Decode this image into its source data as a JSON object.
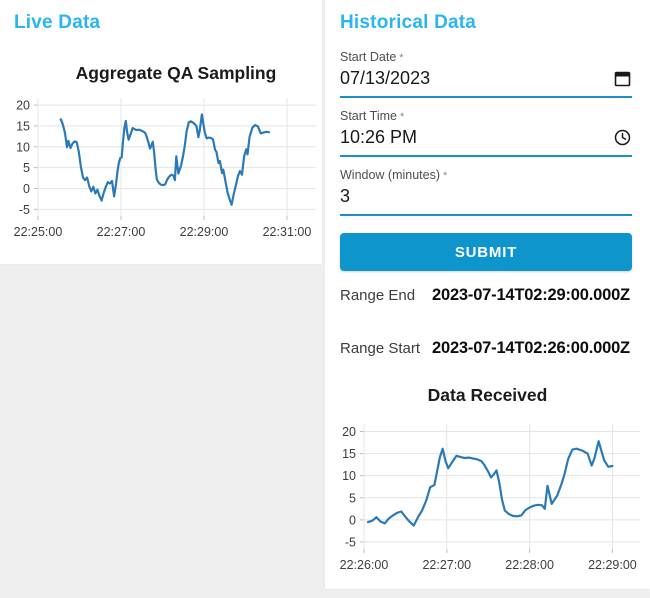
{
  "theme": {
    "accent": "#29b5f2",
    "button_bg": "#0e96cc",
    "line_color": "#2b7ab8",
    "underline": "#1b8fc9"
  },
  "live_panel": {
    "title": "Live Data"
  },
  "historical_panel": {
    "title": "Historical Data",
    "fields": [
      {
        "label": "Start Date",
        "required_mark": "*",
        "value": "07/13/2023",
        "icon": "calendar-icon"
      },
      {
        "label": "Start Time",
        "required_mark": "*",
        "value": "10:26 PM",
        "icon": "clock-icon"
      },
      {
        "label": "Window (minutes)",
        "required_mark": "*",
        "value": "3",
        "icon": "none"
      }
    ],
    "submit_label": "SUBMIT",
    "range_end": {
      "label": "Range End",
      "value": "2023-07-14T02:29:00.000Z"
    },
    "range_start": {
      "label": "Range Start",
      "value": "2023-07-14T02:26:00.000Z"
    }
  },
  "chart_data": [
    {
      "type": "line",
      "title": "Aggregate QA Sampling",
      "xlabel": "",
      "ylabel": "",
      "grid": true,
      "legend": "none",
      "x_axis_base": "22:25:00",
      "x_ticks": [
        {
          "t": 0,
          "label": "22:25:00"
        },
        {
          "t": 120,
          "label": "22:27:00"
        },
        {
          "t": 240,
          "label": "22:29:00"
        },
        {
          "t": 360,
          "label": "22:31:00"
        }
      ],
      "x_domain": [
        0,
        402
      ],
      "y_ticks": [
        20,
        15,
        10,
        5,
        0,
        -5
      ],
      "ylim": [
        -6.6,
        21.7
      ],
      "points": [
        [
          33,
          16.6
        ],
        [
          36,
          15.3
        ],
        [
          39,
          13.3
        ],
        [
          42,
          9.9
        ],
        [
          44,
          11.4
        ],
        [
          47,
          9.7
        ],
        [
          50,
          10.8
        ],
        [
          53,
          11.3
        ],
        [
          56,
          11.1
        ],
        [
          59,
          8.8
        ],
        [
          62,
          5.2
        ],
        [
          65,
          2.6
        ],
        [
          68,
          2.0
        ],
        [
          71,
          2.6
        ],
        [
          74,
          0.6
        ],
        [
          77,
          -0.7
        ],
        [
          80,
          0.4
        ],
        [
          83,
          -1.2
        ],
        [
          86,
          -0.3
        ],
        [
          89,
          -1.8
        ],
        [
          92,
          -2.9
        ],
        [
          95,
          -1.0
        ],
        [
          98,
          0.4
        ],
        [
          101,
          1.5
        ],
        [
          104,
          1.2
        ],
        [
          107,
          1.8
        ],
        [
          110,
          -1.9
        ],
        [
          113,
          1.2
        ],
        [
          115,
          4.1
        ],
        [
          117,
          6.2
        ],
        [
          119,
          7.3
        ],
        [
          121,
          7.5
        ],
        [
          123,
          11.5
        ],
        [
          125,
          14.5
        ],
        [
          127,
          16.2
        ],
        [
          129,
          13.4
        ],
        [
          131,
          11.7
        ],
        [
          134,
          13.1
        ],
        [
          137,
          14.5
        ],
        [
          140,
          14.2
        ],
        [
          143,
          14.0
        ],
        [
          146,
          14.1
        ],
        [
          149,
          13.9
        ],
        [
          152,
          13.7
        ],
        [
          155,
          13.3
        ],
        [
          157,
          12.5
        ],
        [
          160,
          10.9
        ],
        [
          162,
          9.6
        ],
        [
          164,
          10.3
        ],
        [
          166,
          11.2
        ],
        [
          168,
          8.5
        ],
        [
          170,
          4.6
        ],
        [
          172,
          2.1
        ],
        [
          175,
          1.3
        ],
        [
          178,
          0.9
        ],
        [
          181,
          0.8
        ],
        [
          184,
          1.0
        ],
        [
          187,
          2.2
        ],
        [
          190,
          2.9
        ],
        [
          193,
          3.3
        ],
        [
          196,
          3.1
        ],
        [
          198,
          2.0
        ],
        [
          200,
          7.7
        ],
        [
          203,
          3.6
        ],
        [
          207,
          5.5
        ],
        [
          210,
          8.0
        ],
        [
          212,
          10.0
        ],
        [
          215,
          13.8
        ],
        [
          218,
          15.9
        ],
        [
          221,
          16.1
        ],
        [
          225,
          15.7
        ],
        [
          229,
          15.0
        ],
        [
          232,
          12.3
        ],
        [
          234,
          14.0
        ],
        [
          237,
          17.8
        ],
        [
          241,
          13.5
        ],
        [
          244,
          12.0
        ],
        [
          247,
          12.2
        ],
        [
          250,
          12.1
        ],
        [
          253,
          11.8
        ],
        [
          256,
          9.3
        ],
        [
          258,
          8.8
        ],
        [
          261,
          6.1
        ],
        [
          263,
          6.6
        ],
        [
          266,
          3.7
        ],
        [
          268,
          4.5
        ],
        [
          271,
          1.8
        ],
        [
          274,
          -0.9
        ],
        [
          277,
          -2.6
        ],
        [
          280,
          -3.9
        ],
        [
          283,
          -1.4
        ],
        [
          286,
          0.7
        ],
        [
          289,
          2.9
        ],
        [
          292,
          4.2
        ],
        [
          295,
          3.3
        ],
        [
          298,
          7.7
        ],
        [
          301,
          9.4
        ],
        [
          303,
          8.2
        ],
        [
          306,
          12.4
        ],
        [
          310,
          14.6
        ],
        [
          314,
          15.2
        ],
        [
          318,
          14.9
        ],
        [
          322,
          13.2
        ],
        [
          326,
          13.4
        ],
        [
          330,
          13.6
        ],
        [
          334,
          13.5
        ]
      ]
    },
    {
      "type": "line",
      "title": "Data Received",
      "xlabel": "",
      "ylabel": "",
      "grid": true,
      "legend": "none",
      "x_axis_base": "22:26:00",
      "x_ticks": [
        {
          "t": 0,
          "label": "22:26:00"
        },
        {
          "t": 60,
          "label": "22:27:00"
        },
        {
          "t": 120,
          "label": "22:28:00"
        },
        {
          "t": 180,
          "label": "22:29:00"
        }
      ],
      "x_domain": [
        0,
        200
      ],
      "y_ticks": [
        20,
        15,
        10,
        5,
        0,
        -5
      ],
      "ylim": [
        -6.6,
        21.7
      ],
      "points": [
        [
          3,
          -0.5
        ],
        [
          6,
          -0.2
        ],
        [
          9,
          0.6
        ],
        [
          12,
          -0.4
        ],
        [
          15,
          -0.8
        ],
        [
          18,
          0.3
        ],
        [
          21,
          1.0
        ],
        [
          24,
          1.6
        ],
        [
          27,
          1.9
        ],
        [
          30,
          0.7
        ],
        [
          33,
          -0.4
        ],
        [
          36,
          -1.3
        ],
        [
          39,
          0.5
        ],
        [
          42,
          2.1
        ],
        [
          45,
          4.3
        ],
        [
          48,
          7.4
        ],
        [
          51,
          7.9
        ],
        [
          53,
          11.0
        ],
        [
          55,
          14.2
        ],
        [
          57,
          16.1
        ],
        [
          59,
          13.4
        ],
        [
          61,
          11.7
        ],
        [
          64,
          13.1
        ],
        [
          67,
          14.5
        ],
        [
          70,
          14.2
        ],
        [
          73,
          14.0
        ],
        [
          76,
          14.1
        ],
        [
          79,
          13.9
        ],
        [
          82,
          13.7
        ],
        [
          85,
          13.3
        ],
        [
          87,
          12.5
        ],
        [
          90,
          10.9
        ],
        [
          92,
          9.6
        ],
        [
          94,
          10.3
        ],
        [
          96,
          11.2
        ],
        [
          98,
          8.5
        ],
        [
          100,
          4.6
        ],
        [
          102,
          2.1
        ],
        [
          105,
          1.3
        ],
        [
          108,
          0.9
        ],
        [
          111,
          0.8
        ],
        [
          114,
          1.0
        ],
        [
          117,
          2.2
        ],
        [
          120,
          2.8
        ],
        [
          123,
          3.2
        ],
        [
          126,
          3.4
        ],
        [
          129,
          3.3
        ],
        [
          131,
          2.5
        ],
        [
          133,
          7.7
        ],
        [
          136,
          3.6
        ],
        [
          140,
          5.5
        ],
        [
          143,
          8.0
        ],
        [
          145,
          10.0
        ],
        [
          148,
          13.8
        ],
        [
          151,
          15.9
        ],
        [
          154,
          16.1
        ],
        [
          158,
          15.7
        ],
        [
          162,
          15.0
        ],
        [
          165,
          12.3
        ],
        [
          167,
          14.0
        ],
        [
          170,
          17.8
        ],
        [
          174,
          13.5
        ],
        [
          177,
          12.0
        ],
        [
          180,
          12.2
        ]
      ]
    }
  ]
}
